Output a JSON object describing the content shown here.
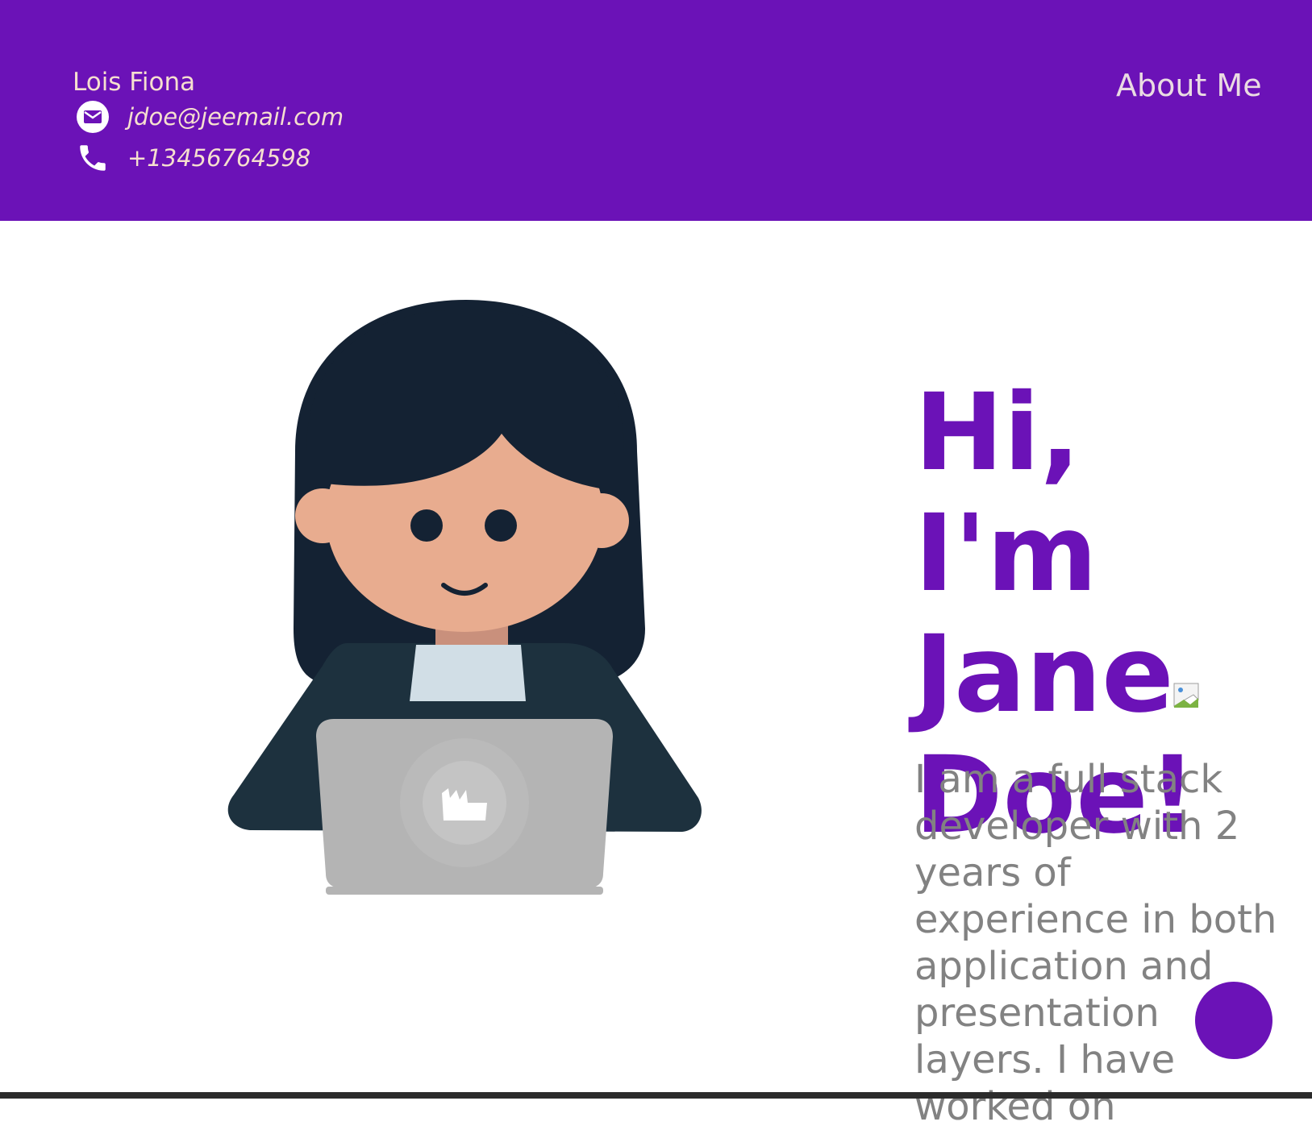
{
  "header": {
    "name": "Lois Fiona",
    "email": "jdoe@jeemail.com",
    "phone": "+13456764598",
    "nav_about": "About Me"
  },
  "hero": {
    "title": "Hi, I'm Jane Doe!",
    "bio": "I am a full stack developer with 2 years of experience in both application and presentation layers. I have worked on"
  },
  "icons": {
    "email": "envelope-icon",
    "phone": "phone-icon",
    "broken_image": "broken-image-icon"
  },
  "colors": {
    "brand": "#6b12b7",
    "header_text": "#f6dfcf",
    "nav_text": "#eadbe2",
    "body_text": "#828282"
  }
}
